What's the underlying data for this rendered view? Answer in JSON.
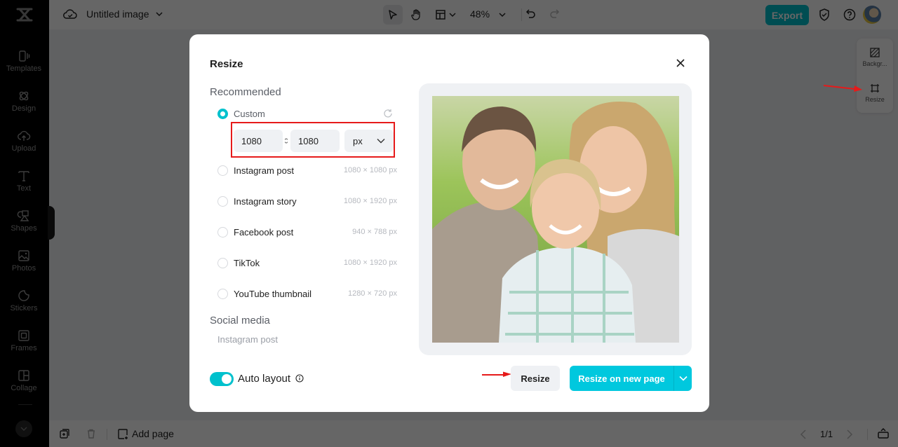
{
  "app": {
    "document_title": "Untitled image",
    "zoom_level": "48%",
    "export_label": "Export",
    "accent_color": "#00c1cd"
  },
  "sidebar": {
    "items": [
      {
        "label": "Templates",
        "icon": "templates-icon"
      },
      {
        "label": "Design",
        "icon": "design-icon"
      },
      {
        "label": "Upload",
        "icon": "upload-icon"
      },
      {
        "label": "Text",
        "icon": "text-icon"
      },
      {
        "label": "Shapes",
        "icon": "shapes-icon"
      },
      {
        "label": "Photos",
        "icon": "photos-icon"
      },
      {
        "label": "Stickers",
        "icon": "stickers-icon"
      },
      {
        "label": "Frames",
        "icon": "frames-icon"
      },
      {
        "label": "Collage",
        "icon": "collage-icon"
      }
    ]
  },
  "right_panel": {
    "items": [
      {
        "label": "Backgr...",
        "icon": "background-icon"
      },
      {
        "label": "Resize",
        "icon": "resize-icon"
      }
    ]
  },
  "bottombar": {
    "add_page_label": "Add page",
    "page_indicator": "1/1"
  },
  "modal": {
    "title": "Resize",
    "recommended_label": "Recommended",
    "custom": {
      "label": "Custom",
      "selected": true,
      "width": "1080",
      "height": "1080",
      "unit": "px"
    },
    "presets": [
      {
        "label": "Instagram post",
        "size": "1080 × 1080 px"
      },
      {
        "label": "Instagram story",
        "size": "1080 × 1920 px"
      },
      {
        "label": "Facebook post",
        "size": "940 × 788 px"
      },
      {
        "label": "TikTok",
        "size": "1080 × 1920 px"
      },
      {
        "label": "YouTube thumbnail",
        "size": "1280 × 720 px"
      }
    ],
    "social_media_label": "Social media",
    "social_media_first": "Instagram post",
    "auto_layout_label": "Auto layout",
    "auto_layout_on": true,
    "resize_label": "Resize",
    "resize_new_page_label": "Resize on new page",
    "preview_alt": "Family photo preview"
  }
}
